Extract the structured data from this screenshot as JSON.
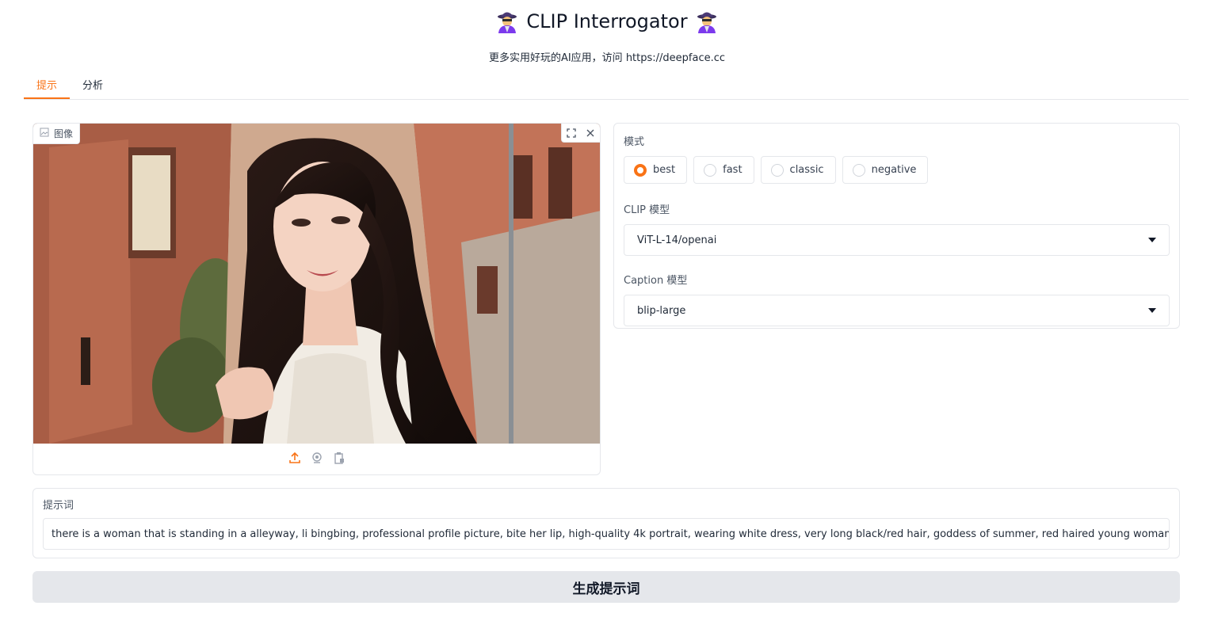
{
  "header": {
    "title": "CLIP Interrogator",
    "title_icon": "detective-emoji-icon",
    "subtitle": "更多实用好玩的AI应用，访问 https://deepface.cc"
  },
  "tabs": [
    {
      "label": "提示",
      "active": true
    },
    {
      "label": "分析",
      "active": false
    }
  ],
  "image_input": {
    "label": "图像",
    "tools": [
      "fullscreen-icon",
      "close-icon"
    ],
    "sources": [
      "upload-icon",
      "webcam-icon",
      "clipboard-icon"
    ]
  },
  "settings": {
    "mode_label": "模式",
    "modes": [
      {
        "label": "best",
        "checked": true
      },
      {
        "label": "fast",
        "checked": false
      },
      {
        "label": "classic",
        "checked": false
      },
      {
        "label": "negative",
        "checked": false
      }
    ],
    "clip_model_label": "CLIP 模型",
    "clip_model_value": "ViT-L-14/openai",
    "caption_model_label": "Caption 模型",
    "caption_model_value": "blip-large"
  },
  "output": {
    "label": "提示词",
    "value": "there is a woman that is standing in a alleyway, li bingbing, professional profile picture, bite her lip, high-quality 4k portrait, wearing white dress, very long black/red hair, goddess of summer, red haired young woman, dark eyebrows"
  },
  "generate_button_label": "生成提示词",
  "colors": {
    "accent": "#f97316",
    "border": "#e5e7eb",
    "button_bg": "#e5e7eb"
  }
}
